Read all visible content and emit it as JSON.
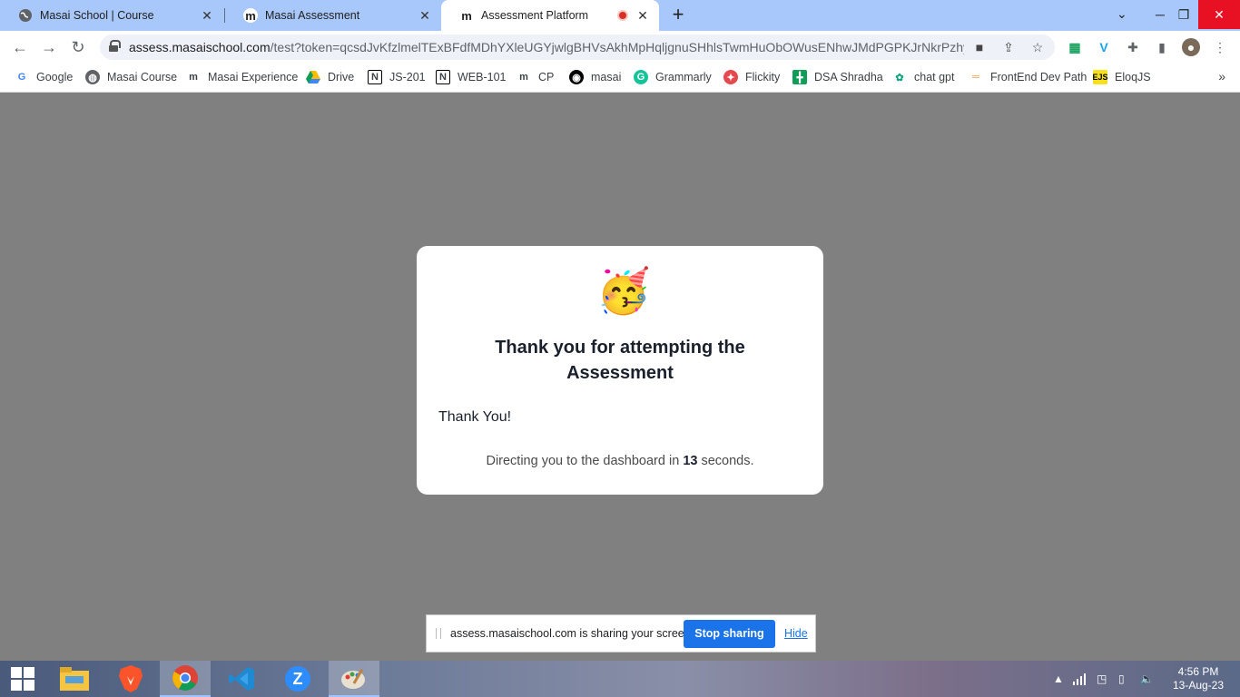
{
  "browser": {
    "tabs": [
      {
        "title": "Masai School | Course",
        "icon": "globe-icon"
      },
      {
        "title": "Masai Assessment",
        "icon": "masai-m-icon"
      },
      {
        "title": "Assessment Platform",
        "icon": "masai-m-icon",
        "active": true,
        "recording": true
      }
    ],
    "url_host": "assess.masaischool.com",
    "url_path": "/test?token=qcsdJvKfzlmelTExBFdfMDhYXleUGYjwlgBHVsAkhMpHqljgnuSHhlsTwmHuObOWusENhwJMdPGPKJrNkrPzhyVG..."
  },
  "bookmarks": [
    {
      "label": "Google",
      "icon": "google-icon"
    },
    {
      "label": "Masai Course",
      "icon": "globe-icon"
    },
    {
      "label": "Masai Experience",
      "icon": "masai-m-icon"
    },
    {
      "label": "Drive",
      "icon": "drive-icon"
    },
    {
      "label": "JS-201",
      "icon": "notion-icon"
    },
    {
      "label": "WEB-101",
      "icon": "notion-icon"
    },
    {
      "label": "CP",
      "icon": "masai-m-icon"
    },
    {
      "label": "masai",
      "icon": "github-icon"
    },
    {
      "label": "Grammarly",
      "icon": "grammarly-icon"
    },
    {
      "label": "Flickity",
      "icon": "flickity-icon"
    },
    {
      "label": "DSA Shradha",
      "icon": "sheets-icon"
    },
    {
      "label": "chat gpt",
      "icon": "openai-icon"
    },
    {
      "label": "FrontEnd Dev Path",
      "icon": "roadmap-icon"
    },
    {
      "label": "EloqJS",
      "icon": "ejs-icon"
    }
  ],
  "modal": {
    "title": "Thank you for attempting the Assessment",
    "message": "Thank You!",
    "redirect_prefix": "Directing you to the dashboard in",
    "redirect_seconds": "13",
    "redirect_suffix": "seconds."
  },
  "sharebar": {
    "text": "assess.masaischool.com is sharing your screen.",
    "stop_label": "Stop sharing",
    "hide_label": "Hide"
  },
  "taskbar": {
    "time": "4:56 PM",
    "date": "13-Aug-23"
  },
  "colors": {
    "tabstrip": "#a8c7fa",
    "overlay": "#808080",
    "primary": "#1a73e8",
    "close_red": "#e81123"
  }
}
